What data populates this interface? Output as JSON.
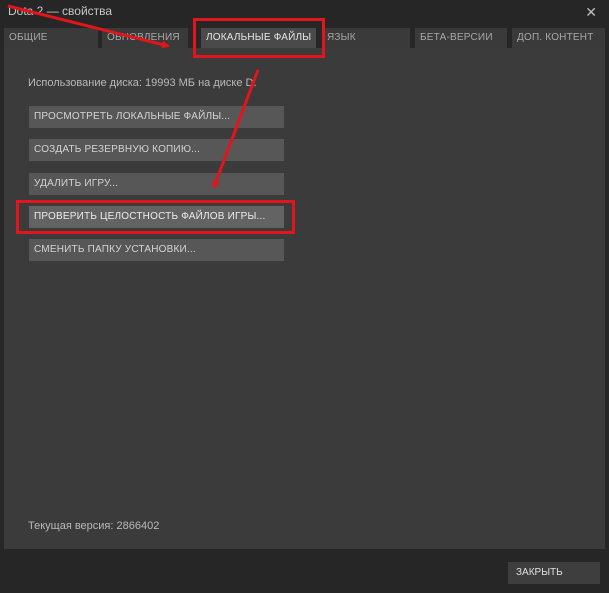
{
  "window": {
    "title": "Dota 2 — свойства",
    "close_glyph": "✕"
  },
  "tabs": [
    {
      "label": "ОБЩИЕ"
    },
    {
      "label": "ОБНОВЛЕНИЯ"
    },
    {
      "label": "ЛОКАЛЬНЫЕ ФАЙЛЫ",
      "active": true
    },
    {
      "label": "ЯЗЫК"
    },
    {
      "label": "БЕТА-ВЕРСИИ"
    },
    {
      "label": "ДОП. КОНТЕНТ"
    }
  ],
  "local_files": {
    "disk_usage": "Использование диска: 19993 МБ на диске D:",
    "buttons": [
      {
        "label": "ПРОСМОТРЕТЬ ЛОКАЛЬНЫЕ ФАЙЛЫ..."
      },
      {
        "label": "СОЗДАТЬ РЕЗЕРВНУЮ КОПИЮ..."
      },
      {
        "label": "УДАЛИТЬ ИГРУ..."
      },
      {
        "label": "ПРОВЕРИТЬ ЦЕЛОСТНОСТЬ ФАЙЛОВ ИГРЫ..."
      },
      {
        "label": "СМЕНИТЬ ПАПКУ УСТАНОВКИ..."
      }
    ],
    "current_version": "Текущая версия: 2866402"
  },
  "footer": {
    "close_label": "ЗАКРЫТЬ"
  },
  "colors": {
    "annotation": "#e3151c",
    "background": "#262626",
    "panel": "#3b3b3b"
  }
}
